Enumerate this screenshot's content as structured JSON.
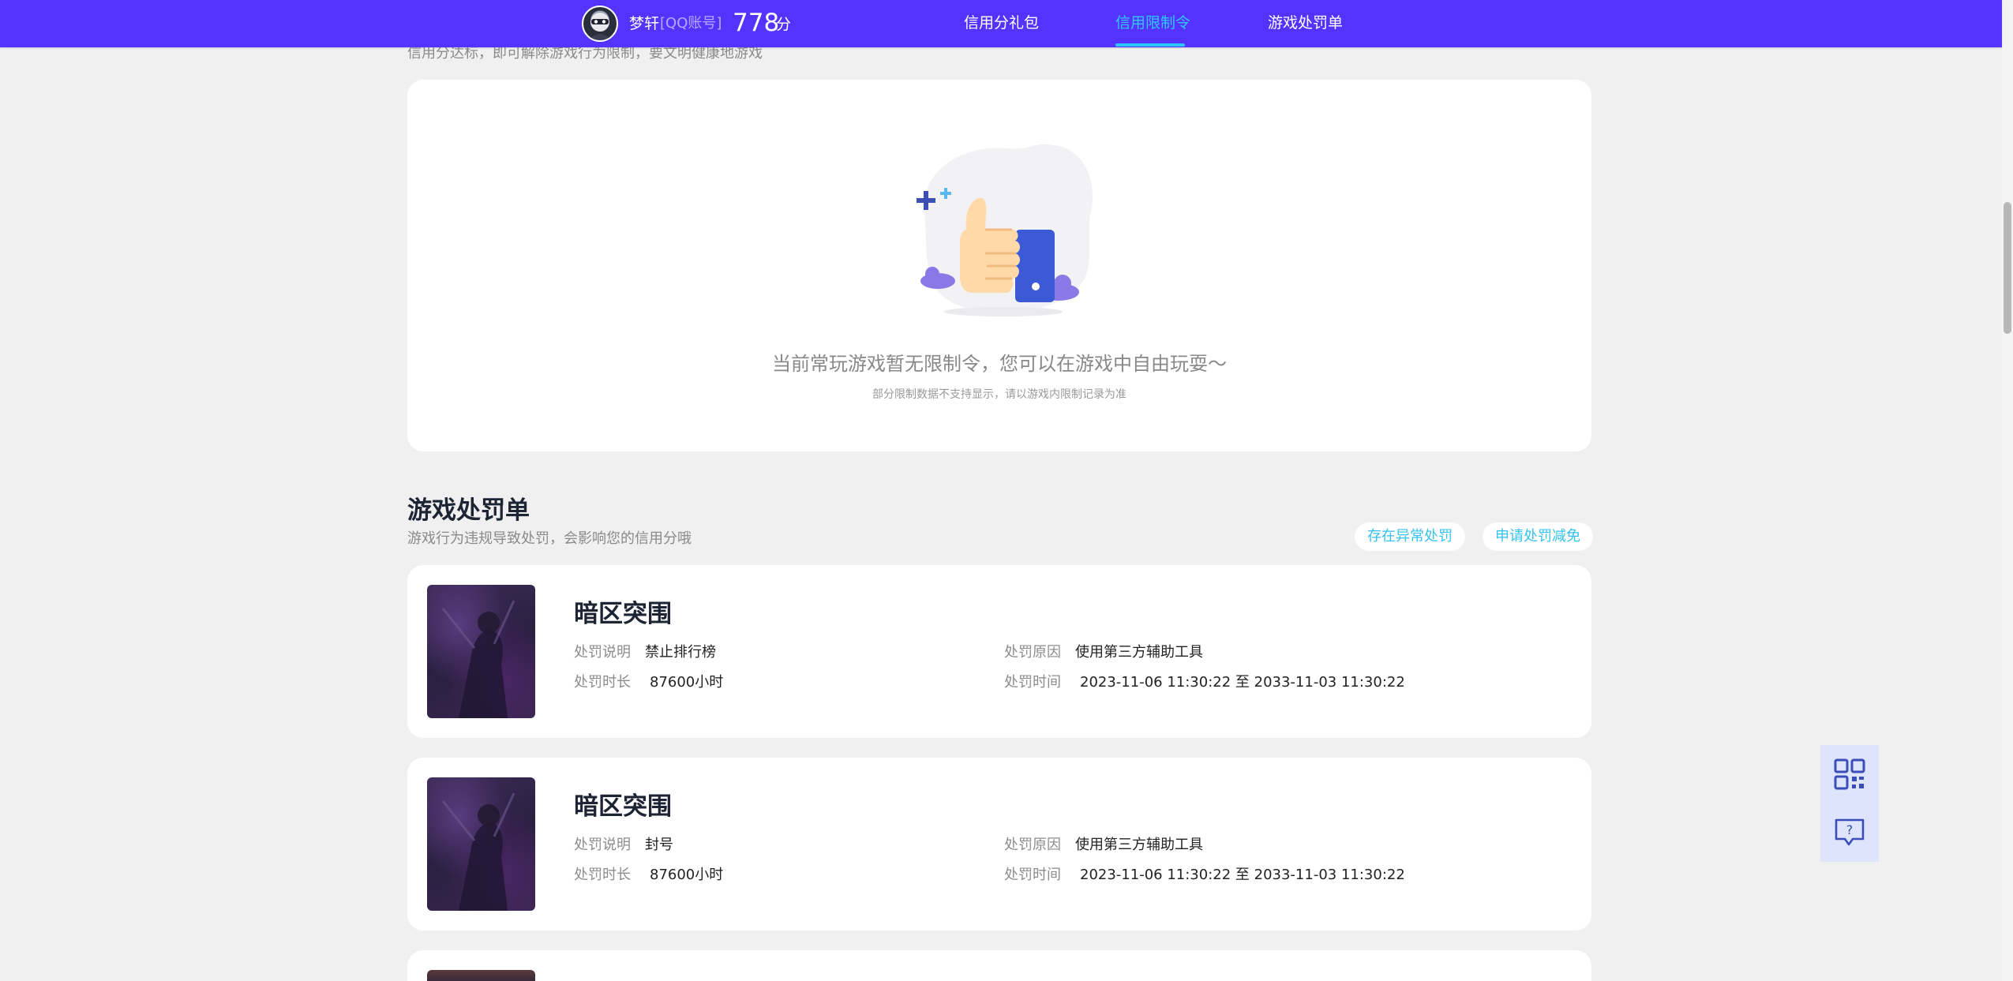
{
  "header": {
    "user_name": "梦轩",
    "account_type": "[QQ账号]",
    "score": "778",
    "score_unit": "分",
    "nav": [
      {
        "label": "信用分礼包",
        "active": false
      },
      {
        "label": "信用限制令",
        "active": true
      },
      {
        "label": "游戏处罚单",
        "active": false
      }
    ]
  },
  "restriction": {
    "subtitle": "信用分达标，即可解除游戏行为限制，要文明健康地游戏",
    "empty_title": "当前常玩游戏暂无限制令，您可以在游戏中自由玩耍～",
    "empty_note": "部分限制数据不支持显示，请以游戏内限制记录为准"
  },
  "penalty": {
    "title": "游戏处罚单",
    "subtitle": "游戏行为违规导致处罚，会影响您的信用分哦",
    "buttons": {
      "abnormal": "存在异常处罚",
      "appeal": "申请处罚减免"
    },
    "labels": {
      "description": "处罚说明",
      "duration": "处罚时长",
      "reason": "处罚原因",
      "time": "处罚时间"
    },
    "items": [
      {
        "game": "暗区突围",
        "description": "禁止排行榜",
        "duration": "87600小时",
        "reason": "使用第三方辅助工具",
        "time": "2023-11-06 11:30:22 至 2033-11-03 11:30:22"
      },
      {
        "game": "暗区突围",
        "description": "封号",
        "duration": "87600小时",
        "reason": "使用第三方辅助工具",
        "time": "2023-11-06 11:30:22 至 2033-11-03 11:30:22"
      }
    ]
  },
  "tools": {
    "qr_icon": "qr-code-icon",
    "help_icon": "help-chat-icon"
  },
  "colors": {
    "brand": "#5533ff",
    "accent": "#2ec8ff",
    "background": "#f0f0f0"
  }
}
